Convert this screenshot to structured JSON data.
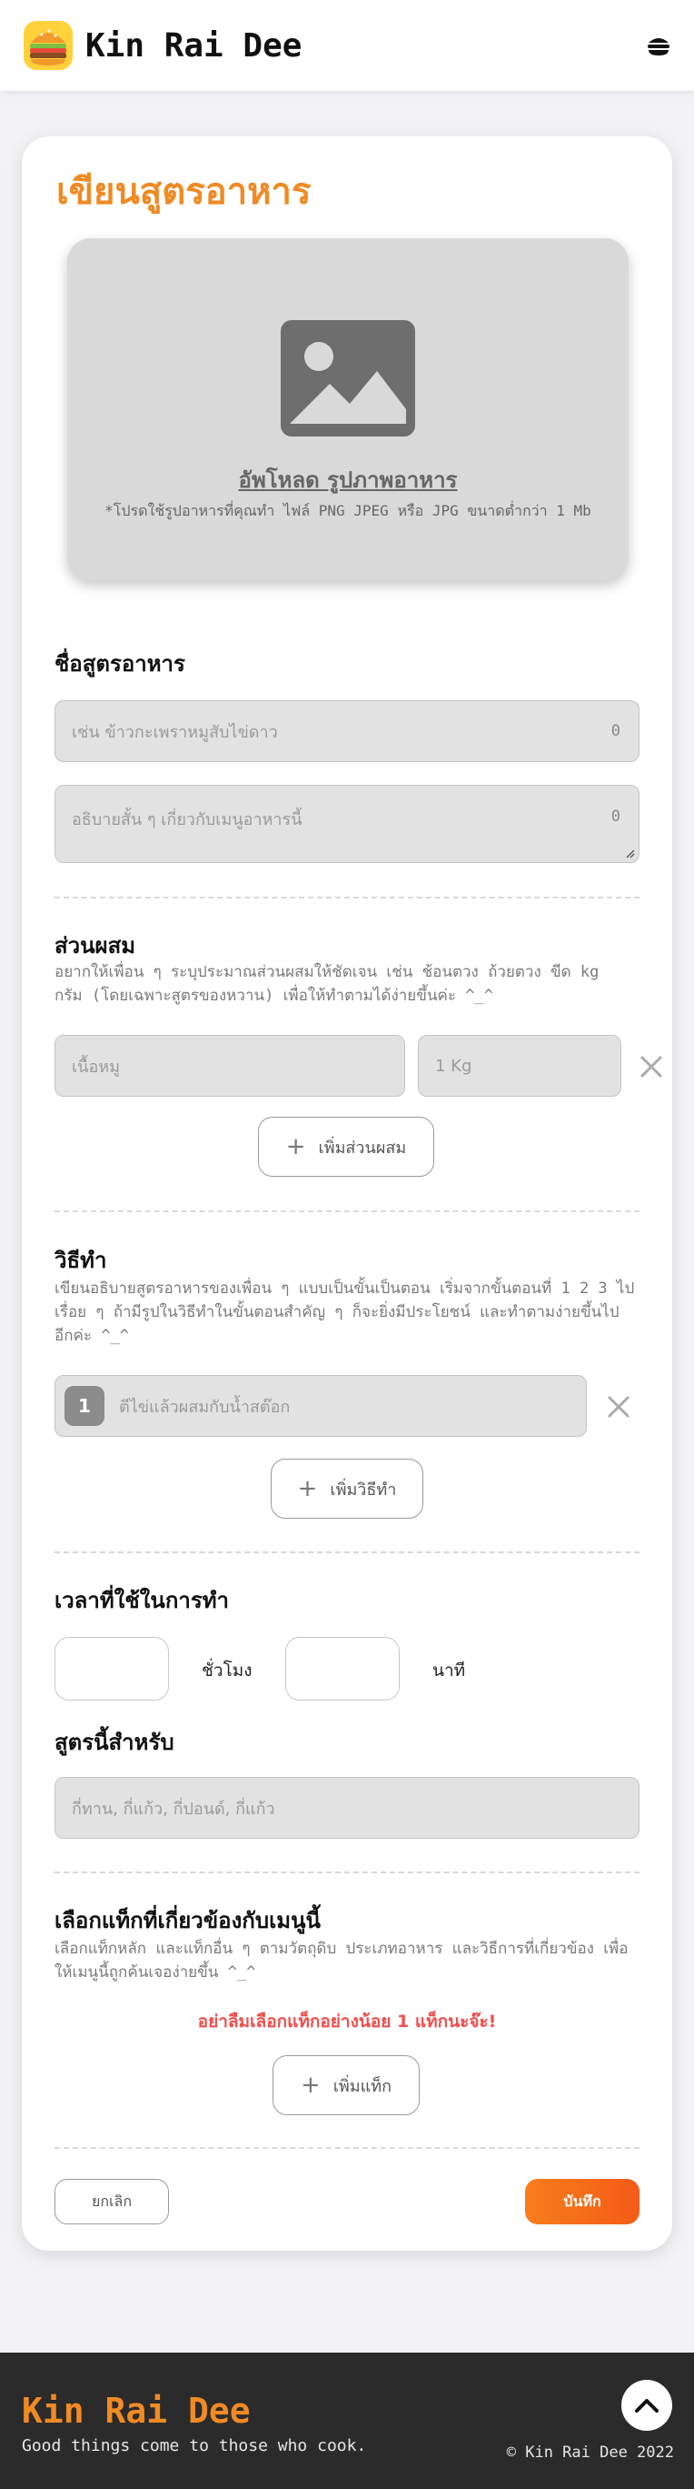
{
  "header": {
    "brand": "Kin Rai Dee",
    "logo_icon": "burger-icon",
    "menu_icon": "hamburger-icon"
  },
  "form": {
    "title": "เขียนสูตรอาหาร",
    "upload": {
      "title": "อัพโหลด  รูปภาพอาหาร",
      "note": "*โปรดใช้รูปอาหารที่คุณทำ ไฟล์ PNG JPEG หรือ JPG ขนาดต่ำกว่า 1 Mb",
      "icon": "image-placeholder-icon"
    },
    "recipe_name": {
      "title": "ชื่อสูตรอาหาร",
      "name_placeholder": "เช่น ข้าวกะเพราหมูสับไข่ดาว",
      "name_count": "0",
      "desc_placeholder": "อธิบายสั้น ๆ เกี่ยวกับเมนูอาหารนี้",
      "desc_count": "0"
    },
    "ingredients": {
      "title": "ส่วนผสม",
      "desc": "อยากให้เพื่อน ๆ ระบุประมาณส่วนผสมให้ชัดเจน เช่น ช้อนตวง ถ้วยตวง ขีด kg กรัม (โดยเฉพาะสูตรของหวาน) เพื่อให้ทำตามได้ง่ายขึ้นค่ะ ^_^",
      "item_placeholder": "เนื้อหมู",
      "amount_placeholder": "1 Kg",
      "add_label": "เพิ่มส่วนผสม"
    },
    "steps": {
      "title": "วิธีทำ",
      "desc": "เขียนอธิบายสูตรอาหารของเพื่อน ๆ แบบเป็นขั้นเป็นตอน เริ่มจากขั้นตอนที่ 1 2 3 ไปเรื่อย ๆ ถ้ามีรูปในวิธีทำในขั้นตอนสำคัญ ๆ ก็จะยิ่งมีประโยชน์ และทำตามง่ายขึ้นไปอีกค่ะ ^_^",
      "step_number": "1",
      "step_placeholder": "ตีไข่แล้วผสมกับน้ำสต๊อก",
      "add_label": "เพิ่มวิธีทำ"
    },
    "time": {
      "title": "เวลาที่ใช้ในการทำ",
      "hours_label": "ชั่วโมง",
      "minutes_label": "นาที"
    },
    "serving": {
      "title": "สูตรนี้สำหรับ",
      "placeholder": "กี่ทาน, กี่แก้ว, กี่ปอนด์, กี่แก้ว"
    },
    "tags": {
      "title": "เลือกแท็กที่เกี่ยวข้องกับเมนูนี้",
      "desc": "เลือกแท็กหลัก และแท็กอื่น ๆ ตามวัตถุดิบ ประเภทอาหาร และวิธีการที่เกี่ยวข้อง เพื่อให้เมนูนี้ถูกค้นเจอง่ายขึ้น ^_^",
      "warning": "อย่าลืมเลือกแท็กอย่างน้อย  1  แท็กนะจ๊ะ!",
      "add_label": "เพิ่มแท็ก"
    },
    "cancel_label": "ยกเลิก",
    "save_label": "บันทึก"
  },
  "footer": {
    "brand": "Kin Rai Dee",
    "tagline": "Good things come to those who cook.",
    "copyright": "© Kin Rai Dee 2022",
    "to_top_icon": "chevron-up-icon"
  },
  "colors": {
    "accent": "#f08a24",
    "warning": "#f04e4e",
    "save": "#f45b18",
    "footer_bg": "#2b2b2b"
  }
}
